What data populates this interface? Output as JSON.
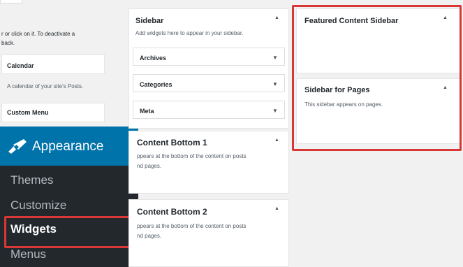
{
  "available_widgets": {
    "description": "r or click on it. To deactivate a\nback.",
    "items": [
      {
        "title": "Calendar",
        "description": "A calendar of your site's Posts."
      },
      {
        "title": "Custom Menu"
      }
    ]
  },
  "admin_menu": {
    "section": "Appearance",
    "icon": "paint-brush-icon",
    "items": [
      "Themes",
      "Customize",
      "Widgets",
      "Menus"
    ],
    "active": "Widgets"
  },
  "sidebar_areas": {
    "sidebar": {
      "title": "Sidebar",
      "description": "Add widgets here to appear in your sidebar.",
      "widgets": [
        "Archives",
        "Categories",
        "Meta"
      ]
    },
    "content_bottom_1": {
      "title": "Content Bottom 1",
      "description": "ppears at the bottom of the content on posts\nnd pages."
    },
    "content_bottom_2": {
      "title": "Content Bottom 2",
      "description": "ppears at the bottom of the content on posts\nnd pages."
    },
    "featured_content_sidebar": {
      "title": "Featured Content Sidebar"
    },
    "sidebar_for_pages": {
      "title": "Sidebar for Pages",
      "description": "This sidebar appears on pages."
    }
  },
  "glyphs": {
    "collapse": "▲",
    "expand": "▼"
  },
  "colors": {
    "menu_bg": "#23282d",
    "menu_active": "#0073aa",
    "highlight": "#d93636"
  }
}
